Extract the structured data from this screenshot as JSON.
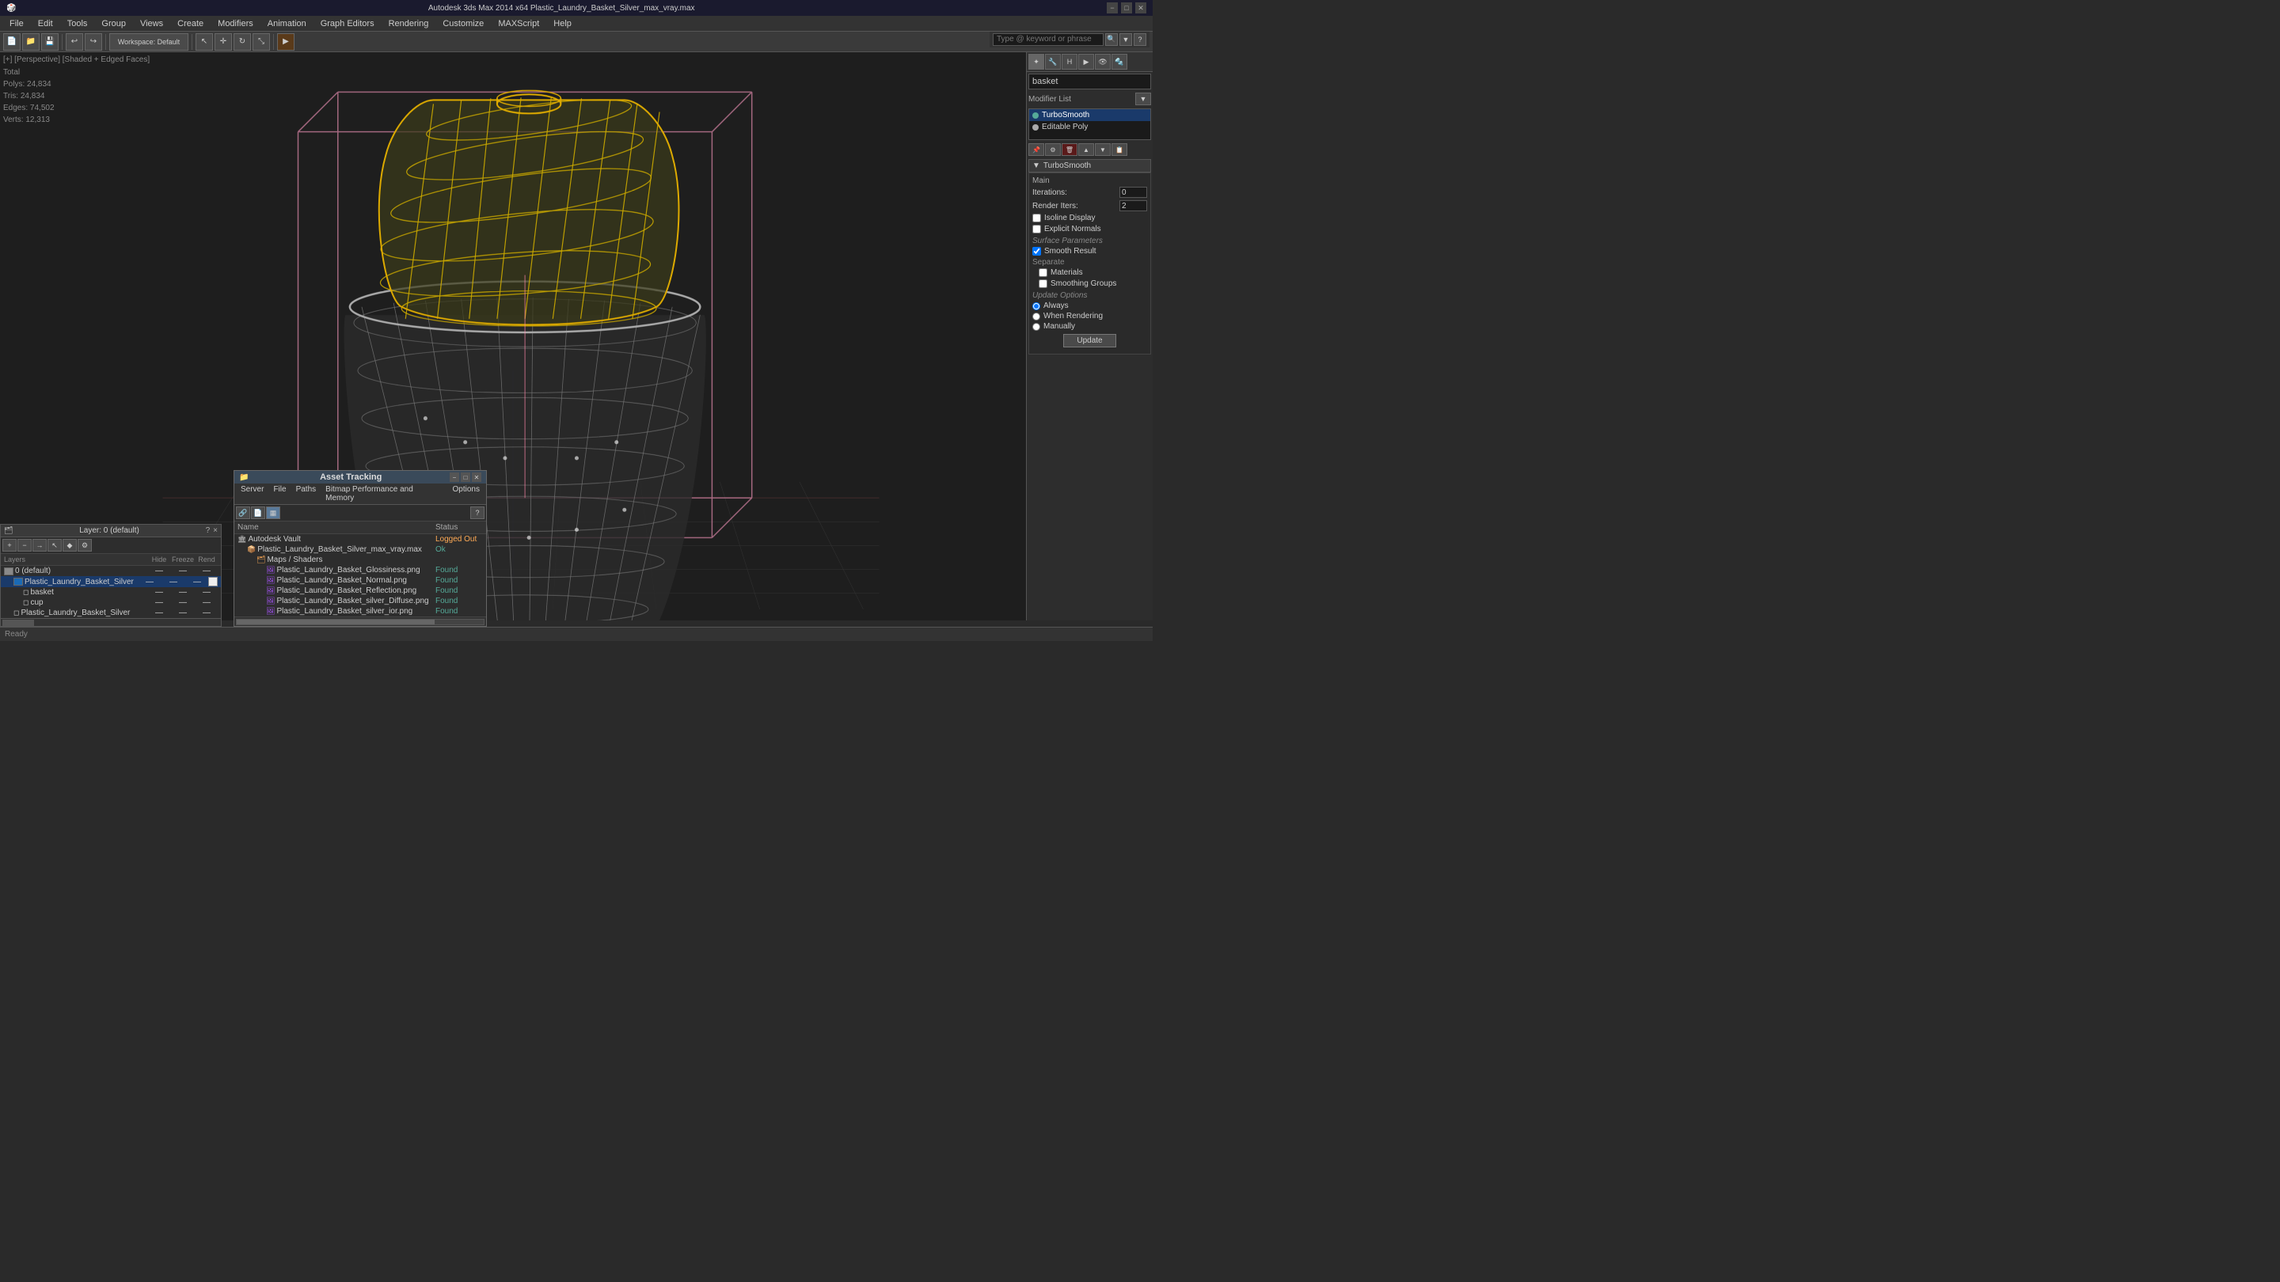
{
  "titlebar": {
    "app_icon": "3dsmax-icon",
    "title": "Autodesk 3ds Max 2014 x64    Plastic_Laundry_Basket_Silver_max_vray.max",
    "minimize_label": "−",
    "maximize_label": "□",
    "close_label": "✕"
  },
  "toolbar": {
    "workspace_label": "Workspace: Default"
  },
  "menubar": {
    "items": [
      {
        "id": "file",
        "label": "File"
      },
      {
        "id": "edit",
        "label": "Edit"
      },
      {
        "id": "tools",
        "label": "Tools"
      },
      {
        "id": "group",
        "label": "Group"
      },
      {
        "id": "views",
        "label": "Views"
      },
      {
        "id": "create",
        "label": "Create"
      },
      {
        "id": "modifiers",
        "label": "Modifiers"
      },
      {
        "id": "animation",
        "label": "Animation"
      },
      {
        "id": "grapheditors",
        "label": "Graph Editors"
      },
      {
        "id": "rendering",
        "label": "Rendering"
      },
      {
        "id": "customize",
        "label": "Customize"
      },
      {
        "id": "maxscript",
        "label": "MAXScript"
      },
      {
        "id": "help",
        "label": "Help"
      }
    ]
  },
  "search": {
    "placeholder": "Type @ keyword or phrase"
  },
  "viewport": {
    "label": "[+] [Perspective] [Shaded + Edged Faces]",
    "stats": {
      "total_label": "Total",
      "polys_label": "Polys:",
      "polys_value": "24,834",
      "tris_label": "Tris:",
      "tris_value": "24,834",
      "edges_label": "Edges:",
      "edges_value": "74,502",
      "verts_label": "Verts:",
      "verts_value": "12,313"
    }
  },
  "right_panel": {
    "object_name": "basket",
    "modifier_list_label": "Modifier List",
    "modifiers": [
      {
        "name": "TurboSmooth",
        "active": true
      },
      {
        "name": "Editable Poly",
        "active": false
      }
    ],
    "turbosmooth": {
      "panel_title": "TurboSmooth",
      "main_section": "Main",
      "iterations_label": "Iterations:",
      "iterations_value": "0",
      "render_iters_label": "Render Iters:",
      "render_iters_value": "2",
      "isoline_display_label": "Isoline Display",
      "isoline_display_checked": false,
      "explicit_normals_label": "Explicit Normals",
      "explicit_normals_checked": false,
      "surface_params_title": "Surface Parameters",
      "smooth_result_label": "Smooth Result",
      "smooth_result_checked": true,
      "separate_label": "Separate",
      "materials_label": "Materials",
      "materials_checked": false,
      "smoothing_groups_label": "Smoothing Groups",
      "smoothing_groups_checked": false,
      "update_options_title": "Update Options",
      "always_label": "Always",
      "always_checked": true,
      "when_rendering_label": "When Rendering",
      "when_rendering_checked": false,
      "manually_label": "Manually",
      "manually_checked": false,
      "update_btn_label": "Update"
    }
  },
  "layers_panel": {
    "title": "Layer: 0 (default)",
    "question_label": "?",
    "close_label": "×",
    "columns": {
      "name": "Layers",
      "hide": "Hide",
      "freeze": "Freeze",
      "render": "Rend"
    },
    "layers": [
      {
        "indent": 0,
        "type": "layer",
        "name": "0 (default)",
        "active": false
      },
      {
        "indent": 1,
        "type": "object",
        "name": "Plastic_Laundry_Basket_Silver",
        "active": true,
        "color": "#1a6ab5"
      },
      {
        "indent": 2,
        "type": "object",
        "name": "basket",
        "active": false
      },
      {
        "indent": 2,
        "type": "object",
        "name": "cup",
        "active": false
      },
      {
        "indent": 1,
        "type": "object",
        "name": "Plastic_Laundry_Basket_Silver",
        "active": false
      }
    ]
  },
  "asset_tracking": {
    "title": "Asset Tracking",
    "menubar": [
      "Server",
      "File",
      "Paths",
      "Bitmap Performance and Memory",
      "Options"
    ],
    "columns": {
      "name": "Name",
      "status": "Status"
    },
    "assets": [
      {
        "indent": 0,
        "type": "vault",
        "name": "Autodesk Vault",
        "status": "Logged Out",
        "status_class": "status-loggedout"
      },
      {
        "indent": 1,
        "type": "file",
        "name": "Plastic_Laundry_Basket_Silver_max_vray.max",
        "status": "Ok",
        "status_class": "status-ok"
      },
      {
        "indent": 2,
        "type": "folder",
        "name": "Maps / Shaders",
        "status": "",
        "status_class": ""
      },
      {
        "indent": 3,
        "type": "image",
        "name": "Plastic_Laundry_Basket_Glossiness.png",
        "status": "Found",
        "status_class": "status-found"
      },
      {
        "indent": 3,
        "type": "image",
        "name": "Plastic_Laundry_Basket_Normal.png",
        "status": "Found",
        "status_class": "status-found"
      },
      {
        "indent": 3,
        "type": "image",
        "name": "Plastic_Laundry_Basket_Reflection.png",
        "status": "Found",
        "status_class": "status-found"
      },
      {
        "indent": 3,
        "type": "image",
        "name": "Plastic_Laundry_Basket_silver_Diffuse.png",
        "status": "Found",
        "status_class": "status-found"
      },
      {
        "indent": 3,
        "type": "image",
        "name": "Plastic_Laundry_Basket_silver_ior.png",
        "status": "Found",
        "status_class": "status-found"
      }
    ]
  }
}
